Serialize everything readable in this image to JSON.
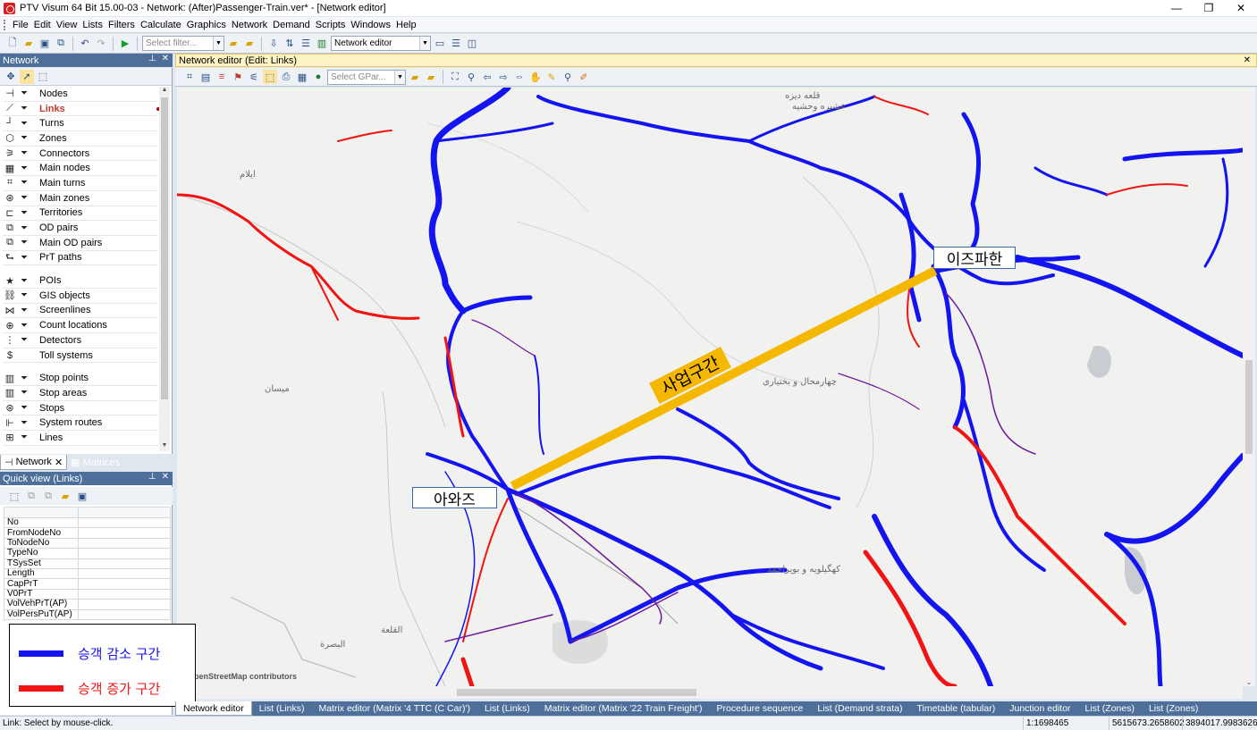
{
  "window": {
    "title": "PTV Visum 64 Bit 15.00-03 - Network: (After)Passenger-Train.ver* - [Network editor]",
    "controls": [
      "—",
      "❐",
      "✕"
    ]
  },
  "menu": [
    "File",
    "Edit",
    "View",
    "Lists",
    "Filters",
    "Calculate",
    "Graphics",
    "Network",
    "Demand",
    "Scripts",
    "Windows",
    "Help"
  ],
  "toolbar": {
    "filter_placeholder": "Select filter...",
    "view_select": "Network editor"
  },
  "network_panel": {
    "title": "Network",
    "items": [
      {
        "label": "Nodes",
        "icon": "node-icon",
        "glyph": "⊣"
      },
      {
        "label": "Links",
        "icon": "link-icon",
        "glyph": "⟋",
        "selected": true
      },
      {
        "label": "Turns",
        "icon": "turn-icon",
        "glyph": "┘"
      },
      {
        "label": "Zones",
        "icon": "zone-icon",
        "glyph": "⬡"
      },
      {
        "label": "Connectors",
        "icon": "connector-icon",
        "glyph": "⚞"
      },
      {
        "label": "Main nodes",
        "icon": "main-node-icon",
        "glyph": "▦"
      },
      {
        "label": "Main turns",
        "icon": "main-turn-icon",
        "glyph": "⌗"
      },
      {
        "label": "Main zones",
        "icon": "main-zone-icon",
        "glyph": "⊛"
      },
      {
        "label": "Territories",
        "icon": "territory-icon",
        "glyph": "⊏"
      },
      {
        "label": "OD pairs",
        "icon": "od-pair-icon",
        "glyph": "⧉"
      },
      {
        "label": "Main OD pairs",
        "icon": "main-od-pair-icon",
        "glyph": "⧉"
      },
      {
        "label": "PrT paths",
        "icon": "prt-path-icon",
        "glyph": "⮑"
      },
      {
        "gap": true
      },
      {
        "label": "POIs",
        "icon": "poi-icon",
        "glyph": "★"
      },
      {
        "label": "GIS objects",
        "icon": "gis-icon",
        "glyph": "⛓"
      },
      {
        "label": "Screenlines",
        "icon": "screenline-icon",
        "glyph": "⋈"
      },
      {
        "label": "Count locations",
        "icon": "count-location-icon",
        "glyph": "⊕"
      },
      {
        "label": "Detectors",
        "icon": "detector-icon",
        "glyph": "⋮"
      },
      {
        "label": "Toll systems",
        "icon": "toll-icon",
        "glyph": "$",
        "nofilter": true
      },
      {
        "gap": true
      },
      {
        "label": "Stop points",
        "icon": "stop-point-icon",
        "glyph": "▥"
      },
      {
        "label": "Stop areas",
        "icon": "stop-area-icon",
        "glyph": "▥"
      },
      {
        "label": "Stops",
        "icon": "stop-icon",
        "glyph": "⊛"
      },
      {
        "label": "System routes",
        "icon": "system-route-icon",
        "glyph": "⊩"
      },
      {
        "label": "Lines",
        "icon": "line-icon",
        "glyph": "⊞"
      }
    ]
  },
  "panel_tabs": [
    {
      "label": "Network",
      "active": true
    },
    {
      "label": "Matrices",
      "active": false
    }
  ],
  "quick_view": {
    "title": "Quick view (Links)",
    "rows": [
      "No",
      "FromNodeNo",
      "ToNodeNo",
      "TypeNo",
      "TSysSet",
      "Length",
      "CapPrT",
      "V0PrT",
      "VolVehPrT(AP)",
      "VolPersPuT(AP)"
    ]
  },
  "map_window": {
    "title": "Network editor (Edit: Links)",
    "gpa_placeholder": "Select GPar...",
    "attribution": "OpenStreetMap contributors",
    "city_labels": {
      "isfahan": "이즈파한",
      "ahvaz": "아와즈"
    },
    "project_label": "사업구간",
    "place_labels": [
      "چهارمحال و بختیاری",
      "کهگیلویه و بویراحمد",
      "ایلام",
      "میسان",
      "البصرة",
      "القلعة",
      "قلعه دیزه",
      "عشیره وحشیه"
    ],
    "colors": {
      "decrease": "#1414f0",
      "increase": "#f01414",
      "mixed": "#6a1a9a",
      "project": "#f5b800"
    }
  },
  "legend": [
    {
      "label": "승객 감소 구간",
      "color": "#1414f0"
    },
    {
      "label": "승객 증가 구간",
      "color": "#f01414"
    }
  ],
  "doc_tabs": [
    {
      "label": "Network editor",
      "active": true
    },
    {
      "label": "List (Links)"
    },
    {
      "label": "Matrix editor (Matrix '4 TTC (C Car)')"
    },
    {
      "label": "List (Links)"
    },
    {
      "label": "Matrix editor (Matrix '22 Train Freight')"
    },
    {
      "label": "Procedure sequence"
    },
    {
      "label": "List (Demand strata)"
    },
    {
      "label": "Timetable (tabular)"
    },
    {
      "label": "Junction editor"
    },
    {
      "label": "List (Zones)"
    },
    {
      "label": "List (Zones)"
    }
  ],
  "status": {
    "message": "Link: Select by mouse-click.",
    "scale": "1:1698465",
    "coord_x": "5615673.2658602",
    "coord_y": "3894017.9983626"
  }
}
